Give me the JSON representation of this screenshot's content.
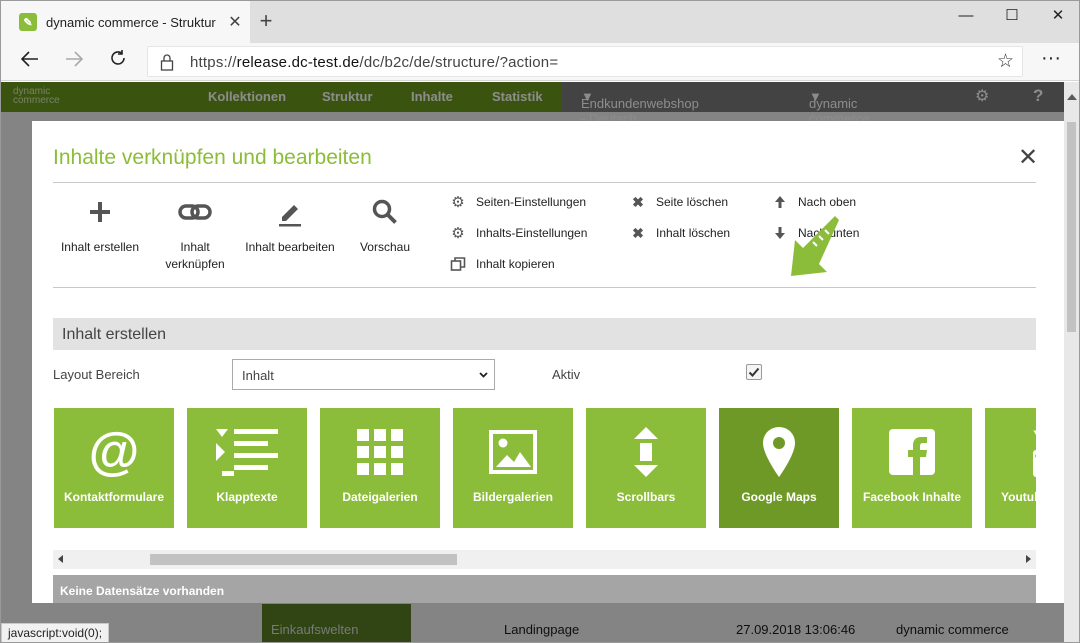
{
  "browser": {
    "tab_title": "dynamic commerce - Struktur",
    "url_prefix": "https://",
    "url_host": "release.dc-test.de",
    "url_path": "/dc/b2c/de/structure/?action=",
    "status_text": "javascript:void(0);"
  },
  "app": {
    "logo_line1": "dynamic",
    "logo_line2": "commerce",
    "nav": [
      "Kollektionen",
      "Struktur",
      "Inhalte",
      "Statistik"
    ],
    "shop_select": "Endkundenwebshop - Deutsch",
    "user_select": "dynamic commerce",
    "row_green": "Einkaufswelten",
    "row_type": "Landingpage",
    "row_date": "27.09.2018 13:06:46",
    "row_user": "dynamic commerce"
  },
  "modal": {
    "title": "Inhalte verknüpfen und bearbeiten",
    "tools": {
      "create": "Inhalt erstellen",
      "link_line1": "Inhalt",
      "link_line2": "verknüpfen",
      "edit": "Inhalt bearbeiten",
      "preview": "Vorschau"
    },
    "actions": {
      "page_settings": "Seiten-Einstellungen",
      "content_settings": "Inhalts-Einstellungen",
      "copy_content": "Inhalt kopieren",
      "delete_page": "Seite löschen",
      "delete_content": "Inhalt löschen",
      "move_up": "Nach oben",
      "move_down": "Nach unten"
    },
    "section_title": "Inhalt erstellen",
    "layout_label": "Layout Bereich",
    "layout_value": "Inhalt",
    "active_label": "Aktiv",
    "active_checked": true,
    "tiles": [
      {
        "label": "Kontaktformulare",
        "icon": "at-icon"
      },
      {
        "label": "Klapptexte",
        "icon": "list-icon"
      },
      {
        "label": "Dateigalerien",
        "icon": "grid-icon"
      },
      {
        "label": "Bildergalerien",
        "icon": "image-icon"
      },
      {
        "label": "Scrollbars",
        "icon": "scroll-icon"
      },
      {
        "label": "Google Maps",
        "icon": "map-pin-icon"
      },
      {
        "label": "Facebook Inhalte",
        "icon": "facebook-icon"
      },
      {
        "label": "Youtub",
        "icon": "youtube-icon"
      }
    ],
    "no_records": "Keine Datensätze vorhanden"
  },
  "colors": {
    "brand_green": "#8cbd3a",
    "tile_active": "#6f9927",
    "header_green": "#6a9a1e"
  }
}
